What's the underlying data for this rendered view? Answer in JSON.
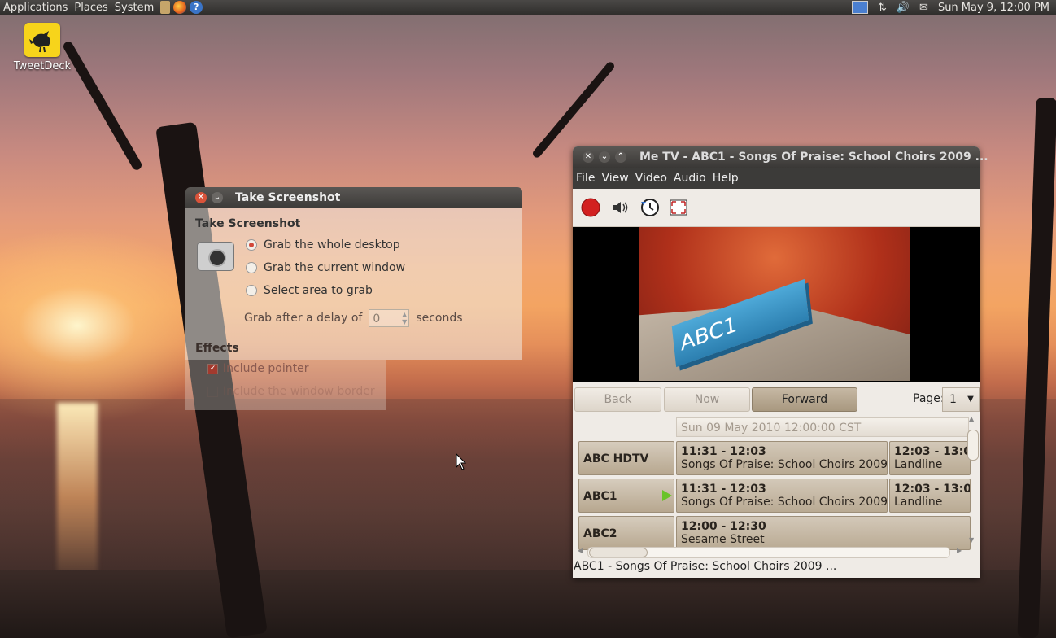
{
  "panel": {
    "menus": [
      "Applications",
      "Places",
      "System"
    ],
    "clock": "Sun May  9, 12:00 PM"
  },
  "desktop": {
    "icon_label": "TweetDeck"
  },
  "screenshot_dialog": {
    "title": "Take Screenshot",
    "heading": "Take Screenshot",
    "options": [
      "Grab the whole desktop",
      "Grab the current window",
      "Select area to grab"
    ],
    "selected_option": "Grab the whole desktop",
    "delay_label": "Grab after a delay of",
    "delay_value": "0",
    "delay_unit": "seconds",
    "effects_heading": "Effects",
    "effects": [
      {
        "label": "Include pointer",
        "checked": true
      },
      {
        "label": "Include the window border",
        "checked": false
      }
    ]
  },
  "metv": {
    "title": "Me TV - ABC1 - Songs Of Praise: School Choirs 2009 ...",
    "menu": [
      "File",
      "View",
      "Video",
      "Audio",
      "Help"
    ],
    "toolbar_icons": [
      "record-icon",
      "volume-icon",
      "schedule-icon",
      "fullscreen-icon"
    ],
    "nav": {
      "back": "Back",
      "now": "Now",
      "forward": "Forward",
      "page_label": "Page:",
      "page_value": "1"
    },
    "epg_date": "Sun 09 May 2010 12:00:00 CST",
    "channels": [
      {
        "name": "ABC HDTV",
        "programs": [
          {
            "time": "11:31 - 12:03",
            "title": "Songs Of Praise: School Choirs 2009 ..."
          },
          {
            "time": "12:03 - 13:0",
            "title": "Landline"
          }
        ]
      },
      {
        "name": "ABC1",
        "programs": [
          {
            "time": "11:31 - 12:03",
            "title": "Songs Of Praise: School Choirs 2009 ..."
          },
          {
            "time": "12:03 - 13:0",
            "title": "Landline"
          }
        ]
      },
      {
        "name": "ABC2",
        "programs": [
          {
            "time": "12:00 - 12:30",
            "title": "Sesame Street"
          }
        ]
      }
    ],
    "video_logo": "ABC1",
    "status": "ABC1 - Songs Of Praise: School Choirs 2009 ..."
  }
}
